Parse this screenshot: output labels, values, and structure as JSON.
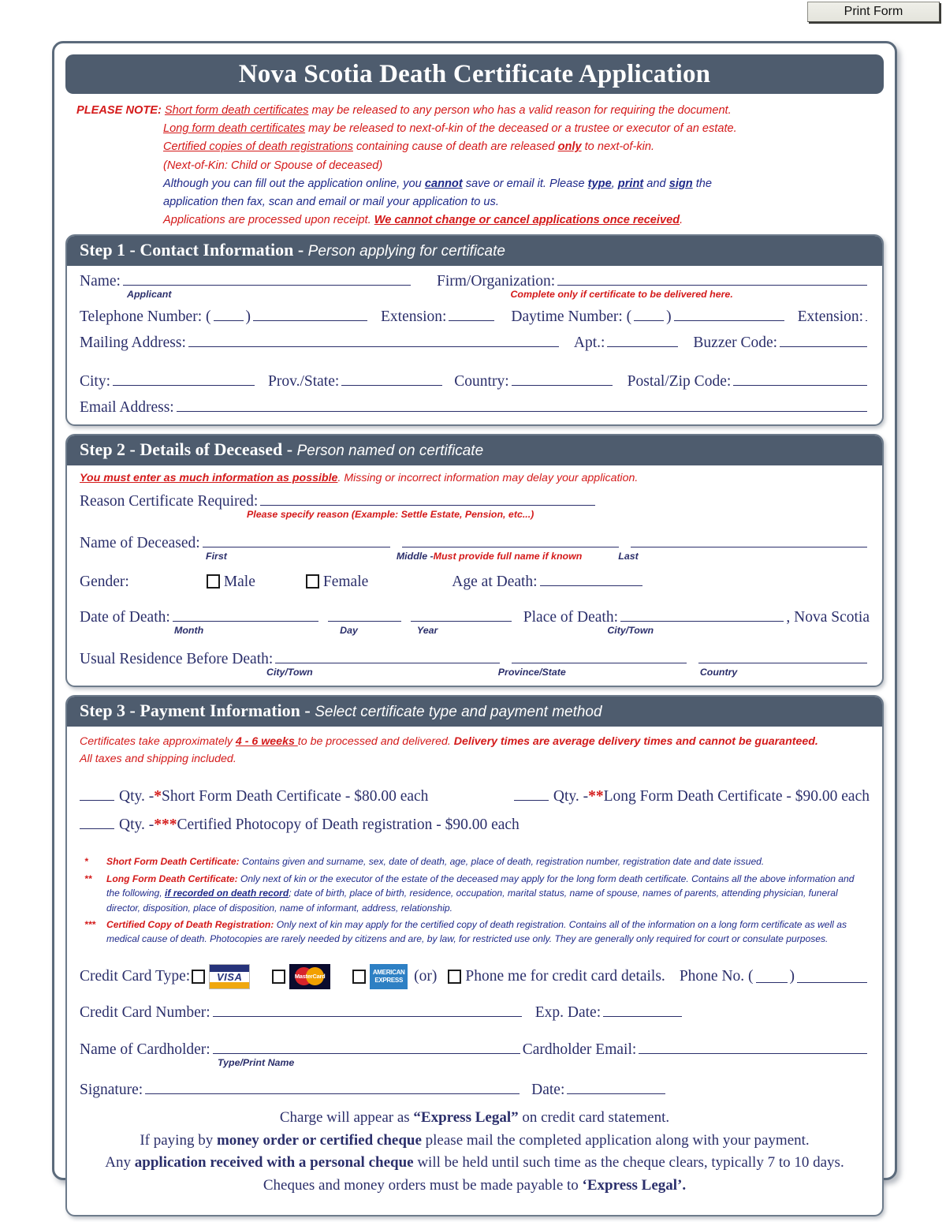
{
  "toolbar": {
    "print_label": "Print Form"
  },
  "form": {
    "title": "Nova Scotia Death Certificate Application",
    "note": {
      "label": "PLEASE NOTE",
      "colon": ":",
      "l1_u": "Short form death certificates",
      "l1_rest": " may be released to any person who has a valid reason for requiring the document.",
      "l2_u": "Long form death certificates",
      "l2_rest": " may be released to next-of-kin of the deceased or a trustee or executor of an estate.",
      "l3_u": "Certified copies of death registrations",
      "l3_mid": " containing cause of death are released ",
      "l3_only": "only",
      "l3_end": " to next-of-kin.",
      "l4": "(Next-of-Kin: Child or Spouse of deceased)",
      "l5_a": "Although you can fill out the application online, you ",
      "l5_cannot": "cannot",
      "l5_b": " save or email it. Please ",
      "l5_type": "type",
      "l5_c": ", ",
      "l5_print": "print",
      "l5_d": " and ",
      "l5_sign": "sign",
      "l5_e": " the",
      "l6": "application then fax, scan and email or mail your application to us.",
      "l7_a": "Applications are processed upon receipt. ",
      "l7_b": "We cannot change or cancel applications once received",
      "l7_c": "."
    }
  },
  "step1": {
    "heading": "Step 1 - Contact Information - ",
    "subheading": "Person applying for certificate",
    "name_label": "Name:",
    "name_caption": "Applicant",
    "firm_label": "Firm/Organization:",
    "firm_caption": "Complete only if certificate to be delivered here.",
    "telephone_label": "Telephone Number: (",
    "paren_close": ")",
    "extension_label": "Extension:",
    "daytime_label": "Daytime Number: (",
    "extension2_label": "Extension:",
    "mailing_label": "Mailing Address:",
    "apt_label": "Apt.:",
    "buzzer_label": "Buzzer Code:",
    "city_label": "City:",
    "prov_label": "Prov./State:",
    "country_label": "Country:",
    "postal_label": "Postal/Zip Code:",
    "email_label": "Email Address:"
  },
  "step2": {
    "heading": "Step 2 - Details of Deceased - ",
    "subheading": "Person named on certificate",
    "warn_u": "You must enter as much information as possible",
    "warn_rest": ". Missing or incorrect information may delay your application.",
    "reason_label": "Reason Certificate Required:",
    "reason_caption": "Please specify reason (Example: Settle Estate, Pension, etc...)",
    "deceased_label": "Name of Deceased:",
    "cap_first": "First",
    "cap_middle_a": "Middle - ",
    "cap_middle_b": "Must provide full name if known",
    "cap_last": "Last",
    "gender_label": "Gender:",
    "male_label": "Male",
    "female_label": "Female",
    "age_label": "Age at Death:",
    "dod_label": "Date of Death:",
    "cap_month": "Month",
    "cap_day": "Day",
    "cap_year": "Year",
    "place_label": "Place of Death:",
    "province_suffix": ", Nova Scotia",
    "cap_citytown": "City/Town",
    "residence_label": "Usual Residence Before Death:",
    "cap_res_city": "City/Town",
    "cap_res_prov": "Province/State",
    "cap_res_country": "Country"
  },
  "step3": {
    "heading": "Step 3 - Payment Information - ",
    "subheading": "Select certificate type and payment method",
    "deliv_a": "Certificates take approximately ",
    "deliv_weeks": " 4 - 6 weeks ",
    "deliv_b": " to be processed and delivered. ",
    "deliv_bold": "Delivery times are average delivery times and cannot be guaranteed.",
    "deliv_c": "All taxes and shipping included.",
    "qty_label": "Qty. - ",
    "items": [
      {
        "stars": "*",
        "text": "Short Form Death Certificate - $80.00 each"
      },
      {
        "stars": "**",
        "text": "Long Form Death Certificate - $90.00 each"
      },
      {
        "stars": "***",
        "text": "Certified Photocopy of Death registration - $90.00 each"
      }
    ],
    "footnotes": [
      {
        "mark": "*",
        "name": "Short Form Death Certificate:",
        "body": " Contains given and surname, sex, date of death, age, place of death, registration number, registration date and date issued."
      },
      {
        "mark": "**",
        "name": "Long Form Death Certificate:",
        "body_a": " Only next of kin or the executor of the estate of the deceased may apply for the long form death certificate. Contains all the above information and the following, ",
        "body_u": "if recorded on death record",
        "body_b": "; date of birth, place of birth, residence, occupation, marital status, name of spouse, names of parents, attending physician, funeral director, disposition, place of disposition, name of informant, address, relationship."
      },
      {
        "mark": "***",
        "name": "Certified Copy of Death Registration:",
        "body": " Only next of kin may apply for the certified copy of death registration. Contains all of the information on a long form certificate as well as medical cause of death. Photocopies are rarely needed by citizens and are, by law, for restricted use only. They are generally only required for court or consulate purposes."
      }
    ],
    "cc_type_label": "Credit Card Type:",
    "visa_label": "VISA",
    "mc_label": "MasterCard",
    "amex_line1": "AMERICAN",
    "amex_line2": "EXPRESS",
    "or_label": "(or)",
    "phone_me_label": "Phone me for credit card details.",
    "phone_no_label": "Phone No. (",
    "paren_close": ")",
    "cc_number_label": "Credit Card Number:",
    "exp_label": "Exp. Date:",
    "cardholder_label": "Name of Cardholder:",
    "cardholder_caption": "Type/Print Name",
    "cardholder_email_label": "Cardholder Email:",
    "signature_label": "Signature:",
    "date_label": "Date:"
  },
  "footer": {
    "l1_a": "Charge will appear as ",
    "l1_b": "“Express Legal”",
    "l1_c": " on credit card statement.",
    "l2_a": "If paying by ",
    "l2_b": "money order or certified cheque",
    "l2_c": " please mail the completed application along with your payment.",
    "l3_a": "Any ",
    "l3_b": "application received with a personal cheque",
    "l3_c": " will be held until such time as the cheque clears, typically 7 to 10 days.",
    "l4_a": "Cheques and money orders must be made payable to ",
    "l4_b": "‘Express Legal’."
  },
  "colors": {
    "header_bar": "#4e5c6e",
    "text_blue": "#2b2f6b",
    "alert_red": "#d41a1a",
    "frame": "#5b6a7b"
  }
}
